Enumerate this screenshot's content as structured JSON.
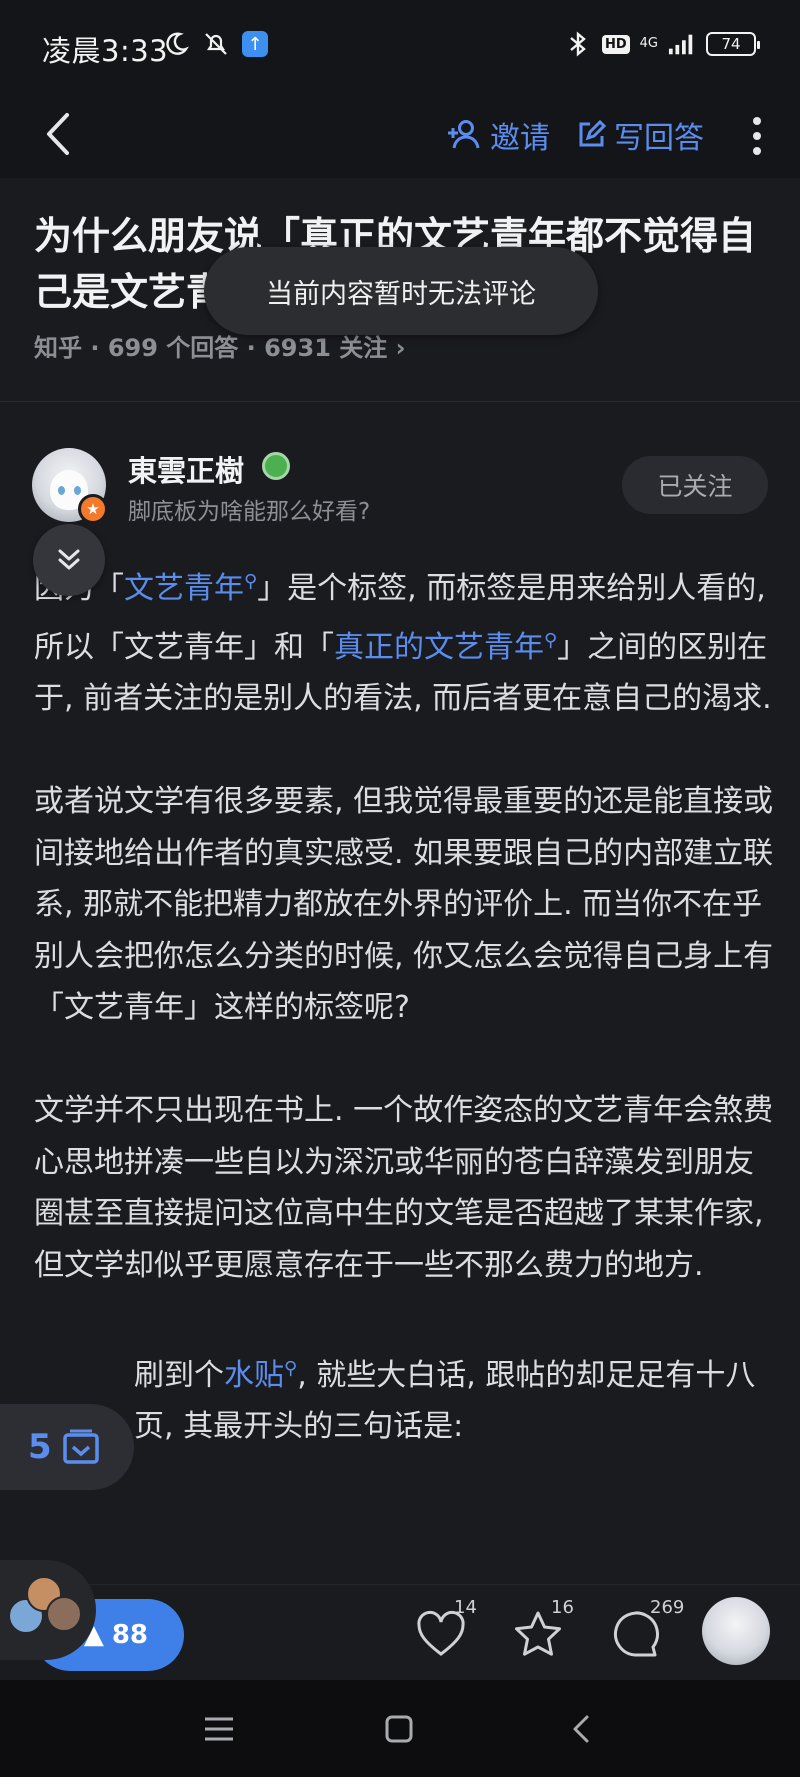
{
  "status_bar": {
    "time": "凌晨3:33",
    "hd": "HD",
    "network": "4G",
    "battery": "74"
  },
  "nav": {
    "invite_label": "邀请",
    "answer_label": "写回答"
  },
  "question": {
    "title": "为什么朋友说「真正的文艺青年都不觉得自己是文艺青",
    "meta": "知乎 · 699 个回答 · 6931 关注 ›"
  },
  "toast": "当前内容暂时无法评论",
  "author": {
    "name": "東雲正樹",
    "bio": "脚底板为啥能那么好看?",
    "follow_label": "已关注"
  },
  "content": {
    "p1_a": "因为「",
    "p1_link1": "文艺青年",
    "p1_b": "」是个标签, 而标签是用来给别人看的, 所以「文艺青年」和「",
    "p1_link2": "真正的文艺青年",
    "p1_c": "」之间的区别在于, 前者关注的是别人的看法, 而后者更在意自己的渴求.",
    "p2": "或者说文学有很多要素, 但我觉得最重要的还是能直接或间接地给出作者的真实感受. 如果要跟自己的内部建立联系, 那就不能把精力都放在外界的评价上. 而当你不在乎别人会把你怎么分类的时候, 你又怎么会觉得自己身上有「文艺青年」这样的标签呢?",
    "p3": "文学并不只出现在书上. 一个故作姿态的文艺青年会煞费心思地拼凑一些自以为深沉或华丽的苍白辞藻发到朋友圈甚至直接提问这位高中生的文笔是否超越了某某作家, 但文学却似乎更愿意存在于一些不那么费力的地方.",
    "p4_a": "刷到个",
    "p4_link": "水贴",
    "p4_b": ", 就些大白话, 跟帖的却足足有十八页, 其最开头的三句话是:"
  },
  "floating": {
    "counter": "5"
  },
  "actions": {
    "upvotes": "88",
    "likes": "14",
    "favorites": "16",
    "comments": "269"
  },
  "colors": {
    "accent": "#5b8def",
    "upvote_bg": "#3f7fe8",
    "background": "#1a1b1f"
  }
}
